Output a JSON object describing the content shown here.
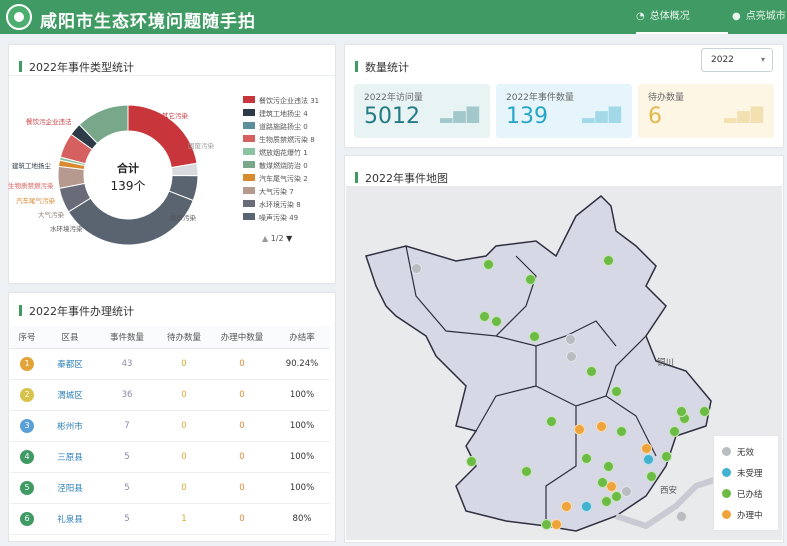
{
  "header": {
    "title": "咸阳市生态环境问题随手拍",
    "nav": [
      "总体概况",
      "点亮城市"
    ]
  },
  "type_panel": {
    "title": "2022年事件类型统计",
    "center_label": "合计",
    "center_value": "139个",
    "legend": [
      {
        "label": "餐饮污企业违法 31",
        "color": "#c8353a"
      },
      {
        "label": "建筑工地扬尘 4",
        "color": "#2d3b48"
      },
      {
        "label": "道路施路扬尘 0",
        "color": "#5e8d9b"
      },
      {
        "label": "生物质禁燃污染 8",
        "color": "#d6605f"
      },
      {
        "label": "燃放烟花爆竹 1",
        "color": "#8cc3a4"
      },
      {
        "label": "散煤燃烧防治 0",
        "color": "#78a889"
      },
      {
        "label": "汽车尾气污染 2",
        "color": "#d88a2f"
      },
      {
        "label": "大气污染 7",
        "color": "#b69a8f"
      },
      {
        "label": "水环境污染 8",
        "color": "#696c78"
      },
      {
        "label": "噪声污染 49",
        "color": "#5a6370"
      }
    ],
    "pager": "1/2",
    "pie_labels": [
      "餐饮污企业违法",
      "其它污染",
      "固废污染",
      "建筑工地扬尘",
      "生物质禁燃污染",
      "汽车尾气污染",
      "大气污染",
      "水环境污染",
      "噪声污染"
    ]
  },
  "stats_panel": {
    "title": "数量统计",
    "year": "2022",
    "cards": [
      {
        "label": "2022年访问量",
        "value": "5012",
        "color": "#237b86",
        "bg": "#e8f3f3"
      },
      {
        "label": "2022年事件数量",
        "value": "139",
        "color": "#26a6c9",
        "bg": "#e6f5fb"
      },
      {
        "label": "待办数量",
        "value": "6",
        "color": "#e2b94f",
        "bg": "#fdf6e5"
      }
    ]
  },
  "handling_panel": {
    "title": "2022年事件办理统计",
    "headers": [
      "序号",
      "区县",
      "事件数量",
      "待办数量",
      "办理中数量",
      "办结率"
    ],
    "rows": [
      {
        "rank": "1",
        "name": "秦都区",
        "count": "43",
        "pending": "0",
        "doing": "0",
        "rate": "90.24%"
      },
      {
        "rank": "2",
        "name": "渭城区",
        "count": "36",
        "pending": "0",
        "doing": "0",
        "rate": "100%"
      },
      {
        "rank": "3",
        "name": "彬州市",
        "count": "7",
        "pending": "0",
        "doing": "0",
        "rate": "100%"
      },
      {
        "rank": "4",
        "name": "三原县",
        "count": "5",
        "pending": "0",
        "doing": "0",
        "rate": "100%"
      },
      {
        "rank": "5",
        "name": "泾阳县",
        "count": "5",
        "pending": "0",
        "doing": "0",
        "rate": "100%"
      },
      {
        "rank": "6",
        "name": "礼泉县",
        "count": "5",
        "pending": "1",
        "doing": "0",
        "rate": "80%"
      }
    ]
  },
  "map_panel": {
    "title": "2022年事件地图",
    "legend": [
      {
        "label": "无效",
        "color": "#b9bcc0"
      },
      {
        "label": "未受理",
        "color": "#40b1cf"
      },
      {
        "label": "已办结",
        "color": "#6cbb45"
      },
      {
        "label": "办理中",
        "color": "#efa43b"
      }
    ],
    "places": [
      "铜川",
      "西安"
    ]
  }
}
